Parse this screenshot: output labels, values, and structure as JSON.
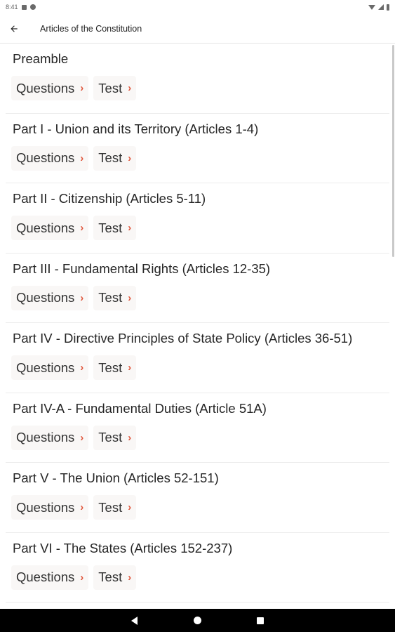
{
  "status_bar": {
    "time": "8:41",
    "left_icons": [
      "sim-icon",
      "sync-icon"
    ],
    "right_icons": [
      "wifi-icon",
      "signal-icon",
      "battery-icon"
    ]
  },
  "app_bar": {
    "back_icon": "arrow-back-icon",
    "title": "Articles of the Constitution"
  },
  "sections": [
    {
      "title": "Preamble",
      "questions_label": "Questions",
      "test_label": "Test"
    },
    {
      "title": "Part I - Union and its Territory (Articles 1-4)",
      "questions_label": "Questions",
      "test_label": "Test"
    },
    {
      "title": "Part II - Citizenship (Articles 5-11)",
      "questions_label": "Questions",
      "test_label": "Test"
    },
    {
      "title": "Part III - Fundamental Rights (Articles 12-35)",
      "questions_label": "Questions",
      "test_label": "Test"
    },
    {
      "title": "Part IV - Directive Principles of State Policy (Articles 36-51)",
      "questions_label": "Questions",
      "test_label": "Test"
    },
    {
      "title": "Part IV-A - Fundamental Duties (Article 51A)",
      "questions_label": "Questions",
      "test_label": "Test"
    },
    {
      "title": "Part V - The Union (Articles 52-151)",
      "questions_label": "Questions",
      "test_label": "Test"
    },
    {
      "title": "Part VI - The States (Articles 152-237)",
      "questions_label": "Questions",
      "test_label": "Test"
    }
  ],
  "chip_chevron": "›",
  "colors": {
    "accent": "#e0573d",
    "chip_background": "#f9f7f6",
    "nav_bar": "#000000"
  },
  "nav_bar": {
    "buttons": [
      "nav-back-icon",
      "nav-home-icon",
      "nav-recents-icon"
    ]
  }
}
